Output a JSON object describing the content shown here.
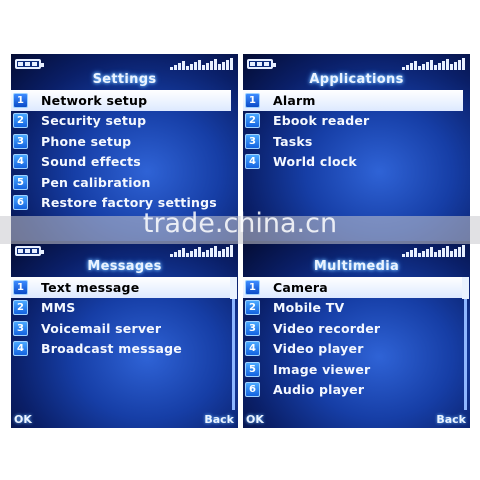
{
  "screens": [
    {
      "title": "Settings",
      "items": [
        {
          "num": "1",
          "label": "Network setup"
        },
        {
          "num": "2",
          "label": "Security setup"
        },
        {
          "num": "3",
          "label": "Phone setup"
        },
        {
          "num": "4",
          "label": "Sound effects"
        },
        {
          "num": "5",
          "label": "Pen calibration"
        },
        {
          "num": "6",
          "label": "Restore factory settings"
        }
      ],
      "selected_index": 0
    },
    {
      "title": "Applications",
      "items": [
        {
          "num": "1",
          "label": "Alarm"
        },
        {
          "num": "2",
          "label": "Ebook reader"
        },
        {
          "num": "3",
          "label": "Tasks"
        },
        {
          "num": "4",
          "label": "World clock"
        }
      ],
      "selected_index": 0
    },
    {
      "title": "Messages",
      "items": [
        {
          "num": "1",
          "label": "Text message"
        },
        {
          "num": "2",
          "label": "MMS"
        },
        {
          "num": "3",
          "label": "Voicemail server"
        },
        {
          "num": "4",
          "label": "Broadcast message"
        }
      ],
      "selected_index": 0,
      "softkeys": {
        "left": "OK",
        "right": "Back"
      }
    },
    {
      "title": "Multimedia",
      "items": [
        {
          "num": "1",
          "label": "Camera"
        },
        {
          "num": "2",
          "label": "Mobile TV"
        },
        {
          "num": "3",
          "label": "Video recorder"
        },
        {
          "num": "4",
          "label": "Video player"
        },
        {
          "num": "5",
          "label": "Image viewer"
        },
        {
          "num": "6",
          "label": "Audio player"
        }
      ],
      "selected_index": 0,
      "softkeys": {
        "left": "OK",
        "right": "Back"
      }
    }
  ],
  "icons": {
    "battery": "battery-icon",
    "signal": "signal-strength-icon"
  },
  "watermark": "trade.china.cn",
  "colors": {
    "highlight": "#ffffff",
    "screen_bg": "#163ea6",
    "number_badge": "#1463e0"
  }
}
